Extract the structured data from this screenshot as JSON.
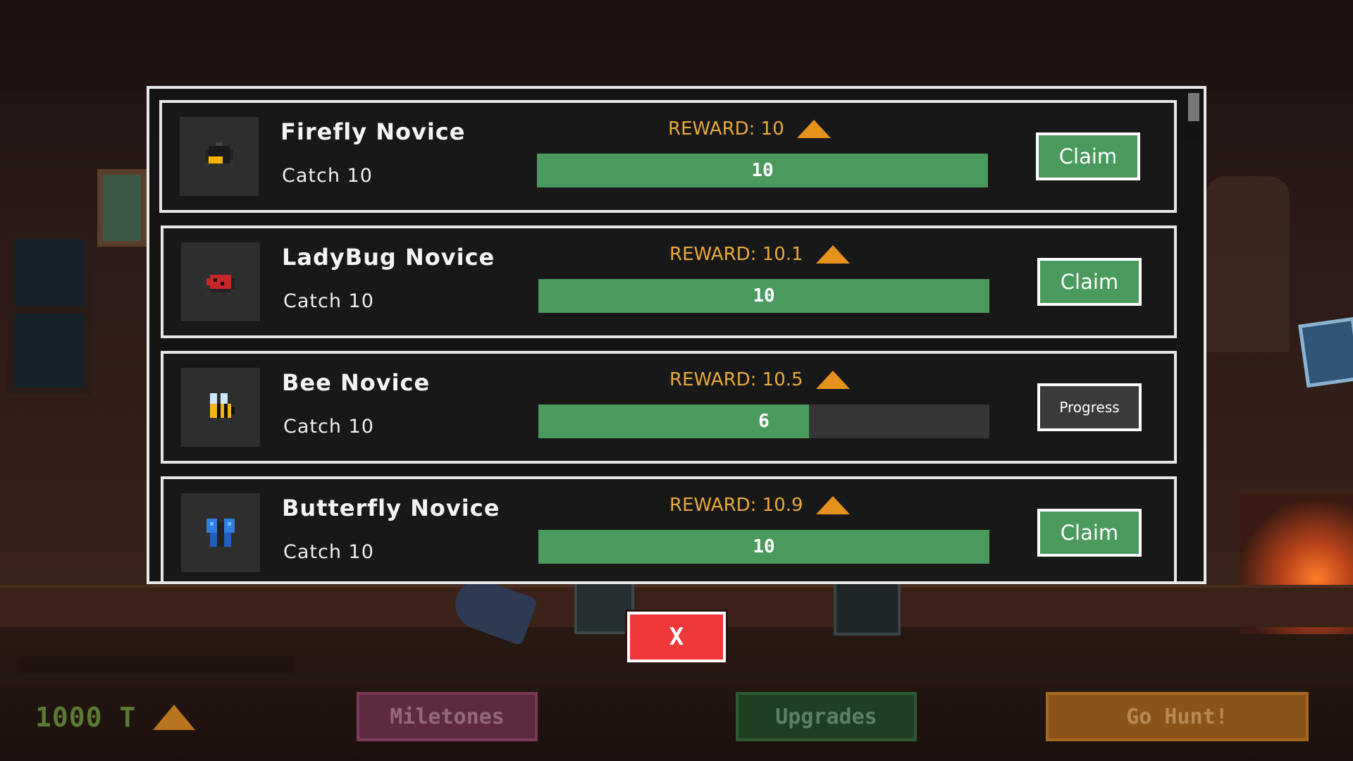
{
  "currency": {
    "value": "1000 T",
    "icon": "resource-pile-icon"
  },
  "quests": [
    {
      "title": "Firefly Novice",
      "desc": "Catch 10",
      "reward": "REWARD: 10",
      "progress_text": "10",
      "progress": 1.0,
      "action": "Claim",
      "action_type": "claim",
      "icon": "firefly-icon"
    },
    {
      "title": "LadyBug Novice",
      "desc": "Catch 10",
      "reward": "REWARD: 10.1",
      "progress_text": "10",
      "progress": 1.0,
      "action": "Claim",
      "action_type": "claim",
      "icon": "ladybug-icon"
    },
    {
      "title": "Bee Novice",
      "desc": "Catch 10",
      "reward": "REWARD: 10.5",
      "progress_text": "6",
      "progress": 0.6,
      "action": "Progress",
      "action_type": "progress",
      "icon": "bee-icon"
    },
    {
      "title": "Butterfly Novice",
      "desc": "Catch 10",
      "reward": "REWARD: 10.9",
      "progress_text": "10",
      "progress": 1.0,
      "action": "Claim",
      "action_type": "claim",
      "icon": "butterfly-icon"
    }
  ],
  "close_label": "X",
  "nav": {
    "milestones": "Miletones",
    "upgrades": "Upgrades",
    "go_hunt": "Go Hunt!"
  },
  "colors": {
    "progress_fill": "#4a9a5e",
    "reward_text": "#e8a93a",
    "close_button": "#f0373a"
  }
}
